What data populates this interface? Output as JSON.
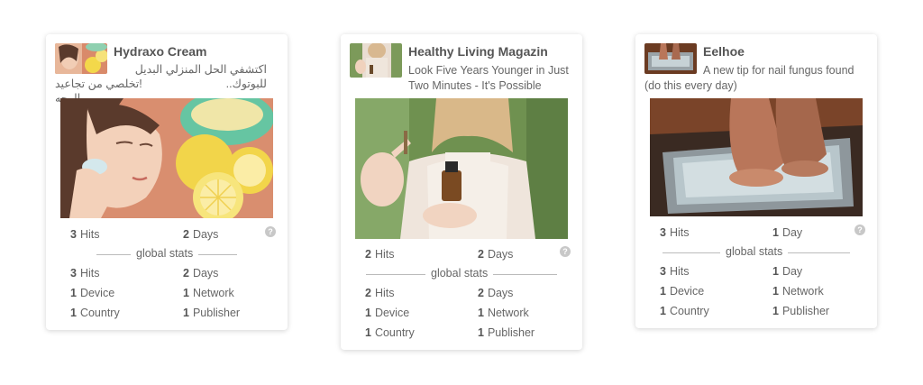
{
  "colors": {
    "text": "#555555",
    "muted": "#666666",
    "divider": "#bbbbbb",
    "help_icon": "#c8c8c8"
  },
  "cards": [
    {
      "brand": "Hydraxo Cream",
      "headline_line1": "اكتشفي الحل المنزلي البديل للبوتوك..",
      "headline_line2": "!تخلصي من تجاعيد الوجه",
      "image": "woman-applying-lemon-illustration",
      "hits": {
        "value": "3",
        "label": "Hits"
      },
      "days": {
        "value": "2",
        "label": "Days"
      },
      "global_label": "global stats",
      "global": {
        "hits": {
          "value": "3",
          "label": "Hits"
        },
        "days": {
          "value": "2",
          "label": "Days"
        },
        "device": {
          "value": "1",
          "label": "Device"
        },
        "network": {
          "value": "1",
          "label": "Network"
        },
        "country": {
          "value": "1",
          "label": "Country"
        },
        "publisher": {
          "value": "1",
          "label": "Publisher"
        }
      },
      "help_icon": "?"
    },
    {
      "brand": "Healthy Living Magazin",
      "headline_line1": "Look Five Years Younger in Just",
      "headline_line2": "Two Minutes - It's Possible",
      "image": "woman-holding-dropper-bottle-photo",
      "hits": {
        "value": "2",
        "label": "Hits"
      },
      "days": {
        "value": "2",
        "label": "Days"
      },
      "global_label": "global stats",
      "global": {
        "hits": {
          "value": "2",
          "label": "Hits"
        },
        "days": {
          "value": "2",
          "label": "Days"
        },
        "device": {
          "value": "1",
          "label": "Device"
        },
        "network": {
          "value": "1",
          "label": "Network"
        },
        "country": {
          "value": "1",
          "label": "Country"
        },
        "publisher": {
          "value": "1",
          "label": "Publisher"
        }
      },
      "help_icon": "?"
    },
    {
      "brand": "Eelhoe",
      "headline_line1": "A new tip for nail fungus found",
      "headline_line2": "(do this every day)",
      "image": "feet-soaking-in-foil-tray-photo",
      "hits": {
        "value": "3",
        "label": "Hits"
      },
      "days": {
        "value": "1",
        "label": "Day"
      },
      "global_label": "global stats",
      "global": {
        "hits": {
          "value": "3",
          "label": "Hits"
        },
        "days": {
          "value": "1",
          "label": "Day"
        },
        "device": {
          "value": "1",
          "label": "Device"
        },
        "network": {
          "value": "1",
          "label": "Network"
        },
        "country": {
          "value": "1",
          "label": "Country"
        },
        "publisher": {
          "value": "1",
          "label": "Publisher"
        }
      },
      "help_icon": "?"
    }
  ]
}
